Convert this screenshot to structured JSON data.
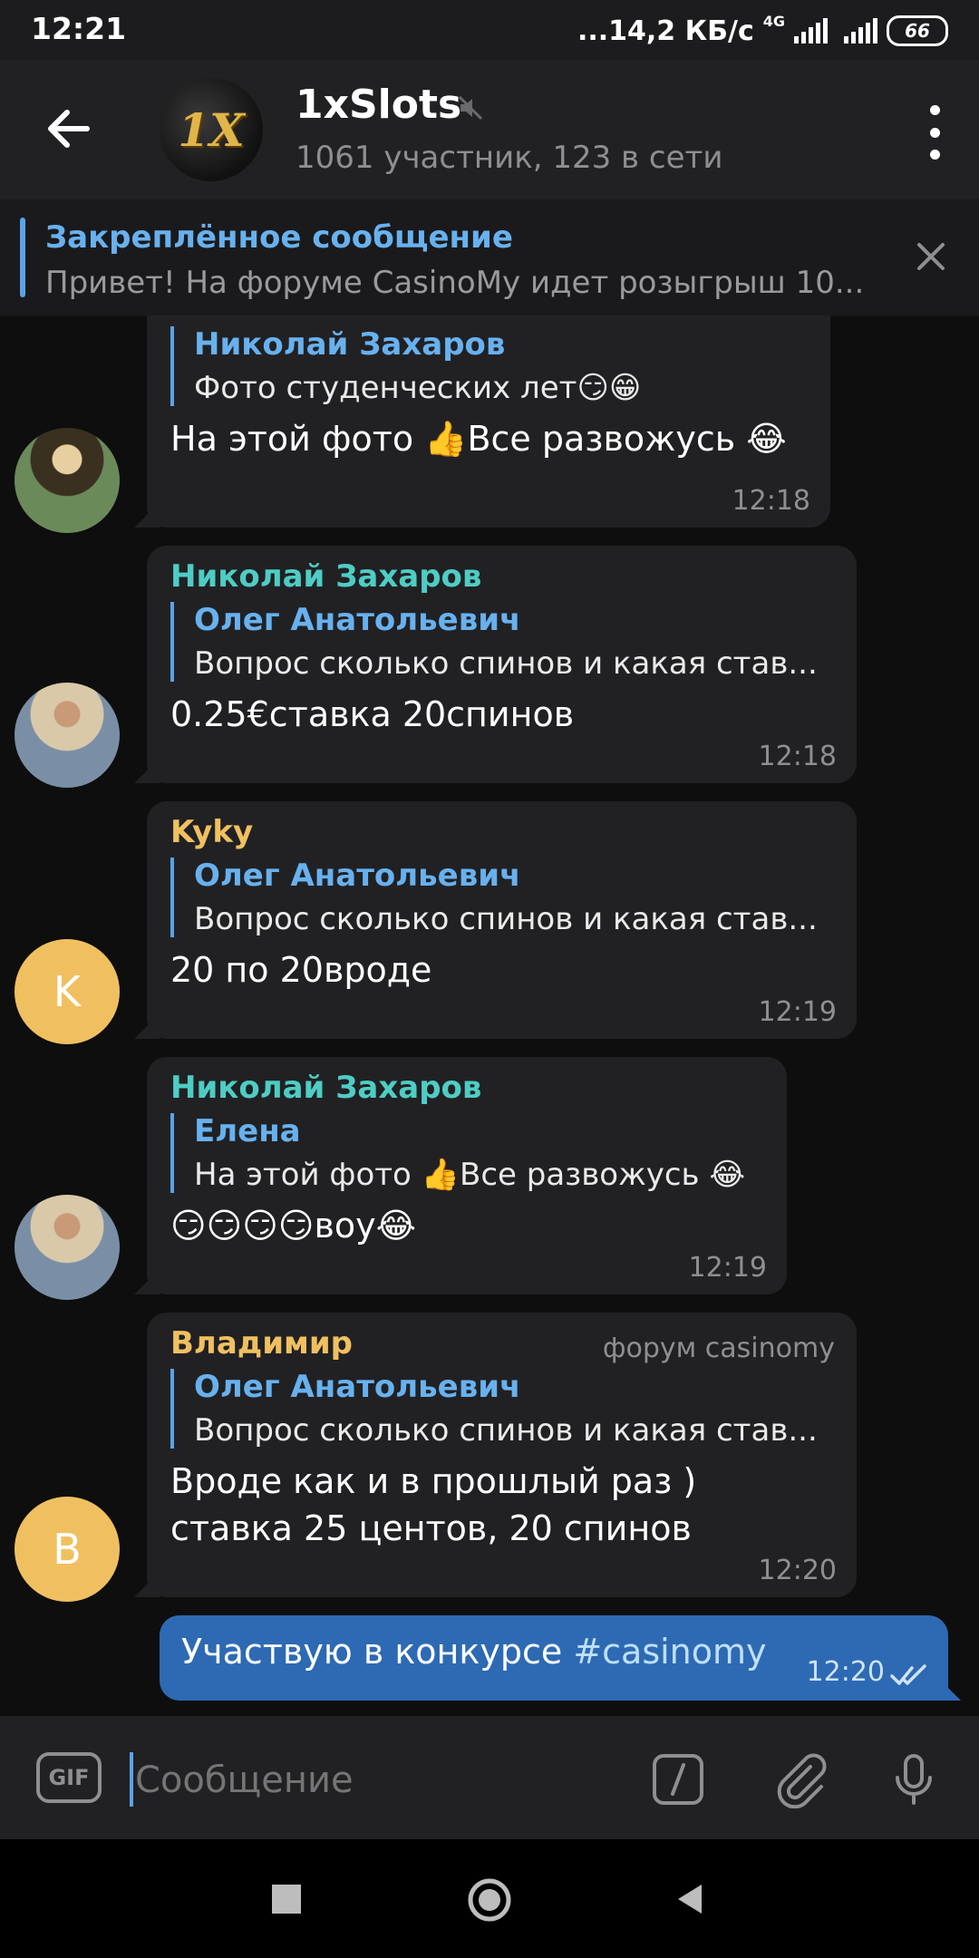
{
  "status_bar": {
    "time": "12:21",
    "network_speed": "...14,2 КБ/с",
    "network_type": "4G",
    "battery": "66"
  },
  "header": {
    "title": "1xSlots",
    "subtitle": "1061 участник, 123 в сети",
    "avatar_text": "1X"
  },
  "pinned": {
    "title": "Закреплённое сообщение",
    "text": "Привет! На форуме CasinoMy идет розыгрыш 10..."
  },
  "messages": [
    {
      "quote_name": "Николай Захаров",
      "quote_text": "Фото студенческих лет😏😁",
      "text": "На этой фото 👍Все развожусь 😂",
      "time": "12:18"
    },
    {
      "sender": "Николай Захаров",
      "sender_color": "#4ecdc4",
      "quote_name": "Олег Анатольевич",
      "quote_text": "Вопрос сколько спинов и какая став...",
      "text": "0.25€ставка 20спинов",
      "time": "12:18"
    },
    {
      "sender": "Kyky",
      "sender_color": "#f0c060",
      "avatar_letter": "K",
      "quote_name": "Олег Анатольевич",
      "quote_text": "Вопрос сколько спинов и какая став...",
      "text": "20 по 20вроде",
      "time": "12:19"
    },
    {
      "sender": "Николай Захаров",
      "sender_color": "#4ecdc4",
      "quote_name": "Елена",
      "quote_text": "На этой фото 👍Все развожусь 😂",
      "text": "😏😏😏😏воу😂",
      "time": "12:19"
    },
    {
      "sender": "Владимир",
      "sender_color": "#f0c060",
      "avatar_letter": "В",
      "tag": "форум casinomy",
      "quote_name": "Олег Анатольевич",
      "quote_text": "Вопрос сколько спинов и какая став...",
      "text_line1": "Вроде как и в прошлый раз )",
      "text_line2": "ставка 25 центов, 20 спинов",
      "time": "12:20"
    }
  ],
  "outgoing": {
    "text": "Участвую в конкурсе ",
    "hashtag": "#casinomy",
    "time": "12:20"
  },
  "input": {
    "gif_label": "GIF",
    "placeholder": "Сообщение"
  }
}
